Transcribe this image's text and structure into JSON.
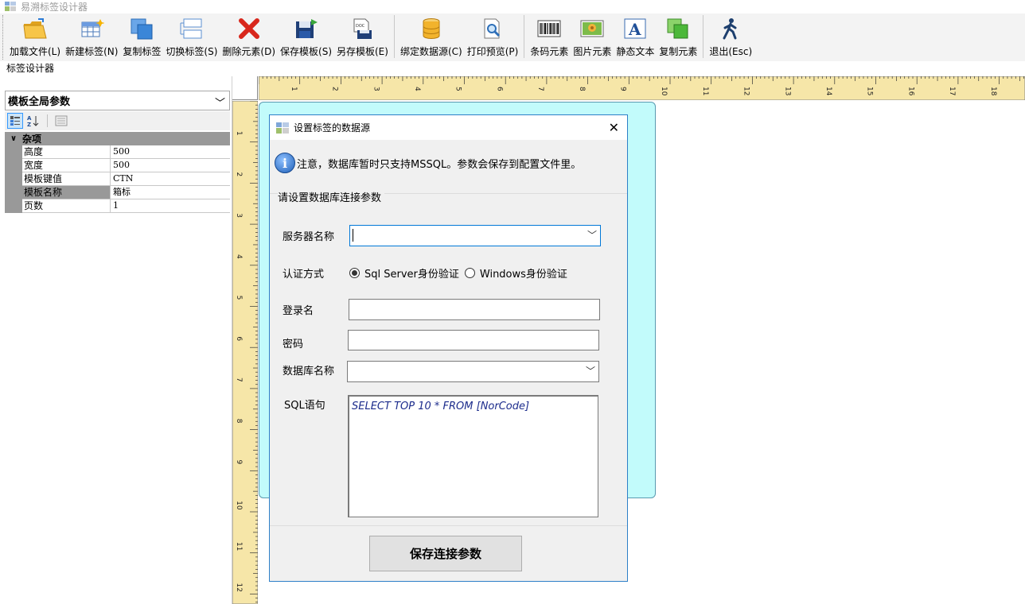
{
  "window": {
    "title": "易溯标签设计器"
  },
  "toolbar": {
    "buttons": [
      {
        "label": "加载文件(L)",
        "icon": "folder-open-icon"
      },
      {
        "label": "新建标签(N)",
        "icon": "new-label-icon"
      },
      {
        "label": "复制标签",
        "icon": "copy-label-icon"
      },
      {
        "label": "切换标签(S)",
        "icon": "switch-label-icon"
      },
      {
        "label": "删除元素(D)",
        "icon": "delete-icon"
      },
      {
        "label": "保存模板(S)",
        "icon": "save-icon"
      },
      {
        "label": "另存模板(E)",
        "icon": "save-as-icon"
      },
      {
        "label": "绑定数据源(C)",
        "icon": "database-icon"
      },
      {
        "label": "打印预览(P)",
        "icon": "print-preview-icon"
      },
      {
        "label": "条码元素",
        "icon": "barcode-icon"
      },
      {
        "label": "图片元素",
        "icon": "image-icon"
      },
      {
        "label": "静态文本",
        "icon": "text-icon"
      },
      {
        "label": "复制元素",
        "icon": "copy-element-icon"
      },
      {
        "label": "退出(Esc)",
        "icon": "exit-icon"
      }
    ]
  },
  "left_panel": {
    "caption": "标签设计器",
    "object_select": "模板全局参数",
    "category": "杂项",
    "properties": [
      {
        "name": "高度",
        "value": "500"
      },
      {
        "name": "宽度",
        "value": "500"
      },
      {
        "name": "模板键值",
        "value": "CTN"
      },
      {
        "name": "模板名称",
        "value": "箱标"
      },
      {
        "name": "页数",
        "value": "1"
      }
    ]
  },
  "rulers": {
    "horizontal": [
      "1",
      "2",
      "3",
      "4",
      "5",
      "6",
      "7",
      "8",
      "9",
      "10",
      "11",
      "12",
      "13",
      "14",
      "15",
      "16",
      "17",
      "18"
    ],
    "vertical": [
      "1",
      "2",
      "3",
      "4",
      "5",
      "6",
      "7",
      "8",
      "9",
      "10",
      "11",
      "12"
    ]
  },
  "dialog": {
    "title": "设置标签的数据源",
    "notice": "注意，数据库暂时只支持MSSQL。参数会保存到配置文件里。",
    "group_title": "请设置数据库连接参数",
    "server_label": "服务器名称",
    "server_value": "",
    "auth_label": "认证方式",
    "auth_options": [
      "Sql Server身份验证",
      "Windows身份验证"
    ],
    "auth_selected": "Sql Server身份验证",
    "login_label": "登录名",
    "login_value": "",
    "password_label": "密码",
    "password_value": "",
    "dbname_label": "数据库名称",
    "dbname_value": "",
    "sql_label": "SQL语句",
    "sql_value": "SELECT TOP 10 * FROM  [NorCode]",
    "save_button": "保存连接参数"
  },
  "colors": {
    "label_paper": "#c2fbfb",
    "ruler": "#f6e6a8",
    "dialog_border": "#2d7fc8",
    "sql_text": "#1c2c8c"
  }
}
